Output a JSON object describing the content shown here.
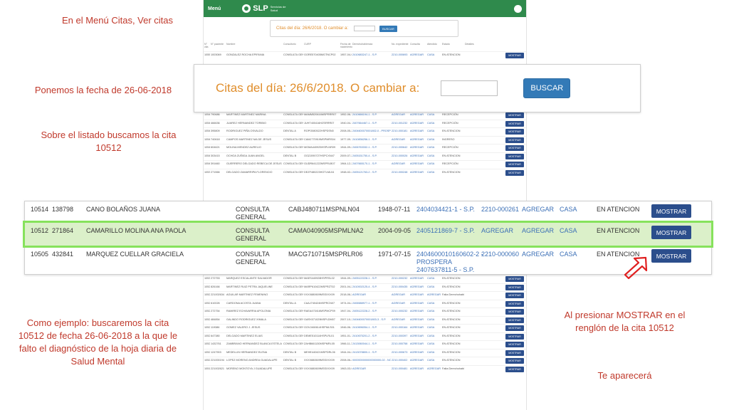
{
  "notes": {
    "menu": "En el Menú Citas, Ver citas",
    "date": "Ponemos la fecha de 26-06-2018",
    "list": "Sobre el listado buscamos la cita 10512",
    "example": "Como ejemplo: buscaremos la cita 10512 de fecha 26-06-2018 a la que le falto el diagnóstico de la hoja diaria de Salud Mental",
    "press": "Al presionar MOSTRAR en el renglón de la cita 10512",
    "appear": "Te aparecerá"
  },
  "app": {
    "menu_label": "Menú",
    "logo_text": "SLP",
    "logo_sub": "Servicios de Salud",
    "mini_search_label": "Citas del día: 26/6/2018. O cambiar a:",
    "mini_search_button": "BUSCAR",
    "headers": [
      "N° cita",
      "N° paciente",
      "Nombre",
      "Consultorio",
      "CURP",
      "Fecha de nacimiento",
      "Derechohabiencia",
      "No. expediente",
      "Consulta",
      "Atendido",
      "Estado",
      "Detalles"
    ],
    "rows_top": [
      {
        "cita": "10551",
        "pac": "1003069",
        "nombre": "GONZALEZ ROCHA EPIFANIA",
        "cons": "CONSULTA GENERAL",
        "curp": "GORE570405MGTNCP02",
        "fecha": "1957-04-05",
        "der": "2410683247-1 - S.P.",
        "exp": "2210-000693",
        "c1": "AGREGAR",
        "c2": "CASA",
        "estado": "EN ATENCION",
        "btn": "MOSTRAR"
      }
    ],
    "rows_mid": [
      {
        "cita": "10546",
        "pac": "790686",
        "nombre": "MARTINEZ MARTINEZ MARINA",
        "cons": "CONSULTA GENERAL",
        "curp": "MAMM520616MSPRRR07",
        "fecha": "1952-06-16",
        "der": "2410666194-1 - S.P.",
        "exp": "AGREGAR",
        "c1": "AGREGAR",
        "c2": "CASA",
        "estado": "RECEPCIÓN",
        "btn": "MOSTRAR"
      },
      {
        "cita": "10545",
        "pac": "466636",
        "nombre": "JUAREZ HERNANDEZ TORIBIO",
        "cons": "CONSULTA GENERAL",
        "curp": "JUHT400416HZSRRR07",
        "fecha": "1940-04-16",
        "der": "2407664467-1 - S.P.",
        "exp": "2210-001232",
        "c1": "AGREGAR",
        "c2": "CASA",
        "estado": "RECEPCIÓN",
        "btn": "MOSTRAR"
      },
      {
        "cita": "10544",
        "pac": "395809",
        "nombre": "RODRIGUEZ PIÑA OSVALDO",
        "cons": "DENTAL A",
        "curp": "ROPO080522HSPDSN0",
        "fecha": "2008-05-22",
        "der": "2404600070001802-0 - PROSPERA",
        "exp": "2210-000181",
        "c1": "AGREGAR",
        "c2": "CASA",
        "estado": "EN ATENCION",
        "btn": "MOSTRAR"
      },
      {
        "cita": "10543",
        "pac": "740618",
        "nombre": "CAMPOS MARTINEZ MA DE JESUS",
        "cons": "CONSULTA GENERAL",
        "curp": "CAMJ770919MSPMRS04",
        "fecha": "1977-09-19",
        "der": "2410836256-1 - S.P.",
        "exp": "AGREGAR",
        "c1": "AGREGAR",
        "c2": "CASA",
        "estado": "INGRESO",
        "btn": "MOSTRAR"
      },
      {
        "cita": "10542",
        "pac": "604621",
        "nombre": "MOLINA MENDEZ AURELIO",
        "cons": "CONSULTA GENERAL",
        "curp": "MOMA440925HSPLNR09",
        "fecha": "1944-09-25",
        "der": "2406763332-1 - S.P.",
        "exp": "2210-000642",
        "c1": "AGREGAR",
        "c2": "CASA",
        "estado": "RECEPCIÓN",
        "btn": "MOSTRAR"
      },
      {
        "cita": "10541",
        "pac": "303415",
        "nombre": "OCHOA ZUÑIGA JUAN ANGEL",
        "cons": "DENTAL B",
        "curp": "OOZJ090727HSPCXN47",
        "fecha": "2009-07-27",
        "der": "2405151750-4 - S.P.",
        "exp": "2210-000026",
        "c1": "AGREGAR",
        "c2": "CASA",
        "estado": "EN ATENCION",
        "btn": "MOSTRAR"
      },
      {
        "cita": "10540",
        "pac": "391660",
        "nombre": "GUERRERO DELGADO REBECA DE JESUS",
        "cons": "CONSULTA GENERAL",
        "curp": "GUDR641222MSPRLB07",
        "fecha": "1964-12-22",
        "der": "2407665170-1 - S.P.",
        "exp": "AGREGAR",
        "c1": "AGREGAR",
        "c2": "CASA",
        "estado": "RECEPCIÓN",
        "btn": "MOSTRAR"
      },
      {
        "cita": "10539",
        "pac": "271566",
        "nombre": "DELGADO ZAMARRIPA FLORENCIO",
        "cons": "CONSULTA GENERAL",
        "curp": "DEZF480223HGTLML04",
        "fecha": "1948-02-23",
        "der": "2405121763-2 - S.P.",
        "exp": "2210-000248",
        "c1": "AGREGAR",
        "c2": "CASA",
        "estado": "EN ATENCION",
        "btn": "MOSTRAR"
      }
    ],
    "rows_bottom": [
      {
        "cita": "10530",
        "pac": "272753",
        "nombre": "MARQUEZ ESCALANTE SALVADOR",
        "cons": "CONSULTA GENERAL",
        "curp": "MAES440928HSPRSL02",
        "fecha": "1944-09-28",
        "der": "2405122228-1 - S.P.",
        "exp": "2210-000232",
        "c1": "AGREGAR",
        "c2": "CASA",
        "estado": "EN ATENCION",
        "btn": "MOSTRAR"
      },
      {
        "cita": "10529",
        "pac": "826166",
        "nombre": "MARTINEZ RUIZ PETRA JAQUELINE",
        "cons": "CONSULTA GENERAL",
        "curp": "MARP610422MSPRZT02",
        "fecha": "2001-04-22",
        "der": "2410002125-4 - S.P.",
        "exp": "2210-000435",
        "c1": "AGREGAR",
        "c2": "CASA",
        "estado": "EN ATENCION",
        "btn": "MOSTRAR"
      },
      {
        "cita": "10528",
        "pac": "221002634",
        "nombre": "AGUILAR MARTINEZ FEMENINO",
        "cons": "CONSULTA GENERAL",
        "curp": "XXXX880609MSSXXX09",
        "fecha": "2018-06-23",
        "der": "AGREGAR",
        "exp": "AGREGAR",
        "c1": "AGREGAR",
        "c2": "AGREGAR",
        "estado": "Falta Derechohabiencia EN ATENCION",
        "btn": "MOSTRAR"
      },
      {
        "cita": "10527",
        "pac": "610026",
        "nombre": "CARDONA ACOSTA JUANA",
        "cons": "DENTAL A",
        "curp": "CAAJ740424MSPRCN07",
        "fecha": "1974-04-24",
        "der": "2406588977-1 - S.P.",
        "exp": "AGREGAR",
        "c1": "AGREGAR",
        "c2": "CASA",
        "estado": "EN ATENCION",
        "btn": "MOSTRAR"
      },
      {
        "cita": "10526",
        "pac": "272754",
        "nombre": "RAMIREZ ECHAVARRIA APOLONIA",
        "cons": "CONSULTA GENERAL",
        "curp": "RAEA470416MSPMCP09",
        "fecha": "1947-04-16",
        "der": "2405122228-2 - S.P.",
        "exp": "2210-000232",
        "c1": "AGREGAR",
        "c2": "CASA",
        "estado": "EN ATENCION",
        "btn": "MOSTRAR"
      },
      {
        "cita": "10525",
        "pac": "484854",
        "nombre": "GALINDO RODRIGUEZ XIMALA",
        "cons": "CONSULTA GENERAL",
        "curp": "GARX071029MSPLDM07",
        "fecha": "2007-10-29",
        "der": "2404600070001803-3 - S.P.",
        "exp": "AGREGAR",
        "c1": "AGREGAR",
        "c2": "CASA",
        "estado": "EN ATENCION",
        "btn": "MOSTRAR"
      },
      {
        "cita": "10524",
        "pac": "119386",
        "nombre": "GOMEZ VALERO J. JESUS",
        "cons": "CONSULTA GENERAL",
        "curp": "GOVJ460614HSPMLS01",
        "fecha": "1946-06-14",
        "der": "2410696054-1 - S.P.",
        "exp": "2210-000164",
        "c1": "AGREGAR",
        "c2": "CASA",
        "estado": "EN ATENCION",
        "btn": "MOSTRAR"
      },
      {
        "cita": "10523",
        "pac": "647380",
        "nombre": "DELGADO MARTINEZ ELIAS",
        "cons": "CONSULTA GENERAL",
        "curp": "DEME510114HSPLRL01",
        "fecha": "1951-01-14",
        "der": "2410675201-2 - S.P.",
        "exp": "2210-000397",
        "c1": "AGREGAR",
        "c2": "CASA",
        "estado": "EN ATENCION",
        "btn": "MOSTRAR"
      },
      {
        "cita": "10522",
        "pac": "1432761",
        "nombre": "ZAMBRANO HERNANDEZ BLANCA ESTELA",
        "cons": "CONSULTA GENERAL",
        "curp": "ZAHB661130MSPMRL05",
        "fecha": "1966-11-30",
        "der": "2413060044-1 - S.P.",
        "exp": "2210-000758",
        "c1": "AGREGAR",
        "c2": "CASA",
        "estado": "EN ATENCION",
        "btn": "MOSTRAR"
      },
      {
        "cita": "10521",
        "pac": "1247903",
        "nombre": "MEDELLIN HERNANDEZ ELENA",
        "cons": "DENTAL B",
        "curp": "MEHE440421MSPDRL06",
        "fecha": "1944-04-21",
        "der": "2413078800-1 - S.P.",
        "exp": "2210-000673",
        "c1": "AGREGAR",
        "c2": "CASA",
        "estado": "EN ATENCION",
        "btn": "MOSTRAR"
      },
      {
        "cita": "10520",
        "pac": "221000194",
        "nombre": "LOPEZ MORENO ANDREA GUADALUPE",
        "cons": "DENTAL B",
        "curp": "XXXX880609MSSXXX09",
        "fecha": "2008-06-22",
        "der": "0000000000000000000-02 - NO CUENTA",
        "exp": "2210-000402",
        "c1": "AGREGAR",
        "c2": "CASA",
        "estado": "EN ATENCION",
        "btn": "MOSTRAR"
      },
      {
        "cita": "10519",
        "pac": "221002621",
        "nombre": "MORENO MONTOYA J GUADALUPE",
        "cons": "CONSULTA GENERAL",
        "curp": "XXXX880609MSSXXX09",
        "fecha": "1963-03-07",
        "der": "AGREGAR",
        "exp": "2210-000481",
        "c1": "AGREGAR",
        "c2": "AGREGAR",
        "estado": "Falta Derechohabiencia EN ATENCION",
        "btn": "MOSTRAR"
      }
    ]
  },
  "zoom_search": {
    "label": "Citas del día: 26/6/2018. O cambiar a:",
    "input_value": "",
    "button": "BUSCAR"
  },
  "zoom_rows": [
    {
      "cita": "10514",
      "pac": "138798",
      "nombre": "CANO BOLAÑOS JUANA",
      "cons": "CONSULTA GENERAL",
      "curp": "CABJ480711MSPNLN04",
      "fecha": "1948-07-11",
      "der": "2404034421-1 - S.P.",
      "exp": "2210-000261",
      "c1": "AGREGAR",
      "c2": "CASA",
      "estado": "EN ATENCION",
      "btn": "MOSTRAR"
    },
    {
      "cita": "10512",
      "pac": "271864",
      "nombre": "CAMARILLO MOLINA ANA PAOLA",
      "cons": "CONSULTA GENERAL",
      "curp": "CAMA040905MSPMLNA2",
      "fecha": "2004-09-05",
      "der": "2405121869-7 - S.P.",
      "exp": "AGREGAR",
      "c1": "AGREGAR",
      "c2": "CASA",
      "estado": "EN ATENCION",
      "btn": "MOSTRAR"
    },
    {
      "cita": "10505",
      "pac": "432841",
      "nombre": "MARQUEZ CUELLAR GRACIELA",
      "cons": "CONSULTA GENERAL",
      "curp": "MACG710715MSPRLR06",
      "fecha": "1971-07-15",
      "der": "2404600010160602-2 - PROSPERA 2407637811-5 - S.P.",
      "exp": "2210-000060",
      "c1": "AGREGAR",
      "c2": "CASA",
      "estado": "EN ATENCION",
      "btn": "MOSTRAR"
    }
  ],
  "colors": {
    "note_text": "#c0392b",
    "navbar": "#2f8a4c",
    "button": "#2b4e8c",
    "search_button": "#337ab7",
    "highlight_fill": "#dbf0c9",
    "highlight_border": "#86e25c",
    "date_label": "#e08e2c",
    "arrow": "#e02020"
  },
  "icons": {
    "arrow": "arrow-pointer-icon",
    "user": "user-avatar-icon"
  }
}
